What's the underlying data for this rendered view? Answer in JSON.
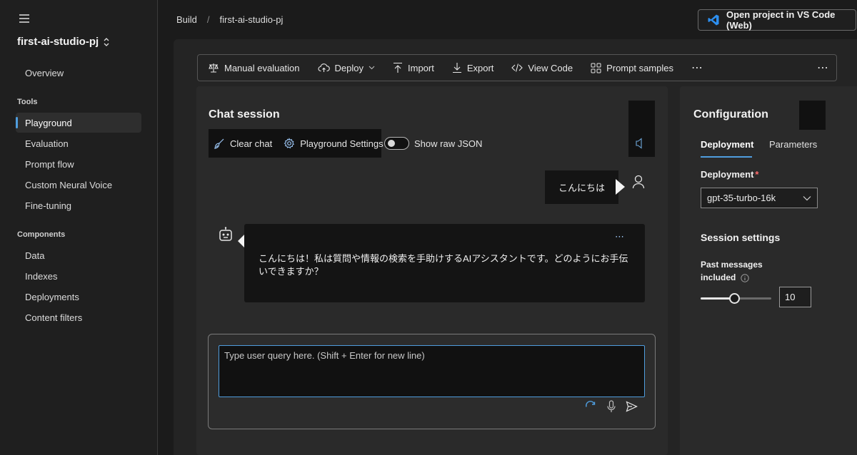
{
  "sidebar": {
    "project_name": "first-ai-studio-pj",
    "overview": "Overview",
    "tools_label": "Tools",
    "tools": [
      {
        "label": "Playground",
        "active": true
      },
      {
        "label": "Evaluation"
      },
      {
        "label": "Prompt flow"
      },
      {
        "label": "Custom Neural Voice"
      },
      {
        "label": "Fine-tuning"
      }
    ],
    "components_label": "Components",
    "components": [
      {
        "label": "Data"
      },
      {
        "label": "Indexes"
      },
      {
        "label": "Deployments"
      },
      {
        "label": "Content filters"
      }
    ]
  },
  "breadcrumb": [
    "Build",
    "first-ai-studio-pj"
  ],
  "header": {
    "vscode_button": "Open project in VS Code (Web)"
  },
  "toolbar": {
    "manual_evaluation": "Manual evaluation",
    "deploy": "Deploy",
    "import": "Import",
    "export": "Export",
    "view_code": "View Code",
    "prompt_samples": "Prompt samples"
  },
  "chat": {
    "title": "Chat session",
    "clear_chat": "Clear chat",
    "playground_settings": "Playground Settings",
    "show_raw_json": "Show raw JSON",
    "show_raw_json_on": false,
    "user_message": "こんにちは",
    "assistant_message": "こんにちは！私は質問や情報の検索を手助けするAIアシスタントです。どのようにお手伝いできますか？",
    "input_placeholder": "Type user query here. (Shift + Enter for new line)"
  },
  "config": {
    "title": "Configuration",
    "tabs": {
      "deployment": "Deployment",
      "parameters": "Parameters"
    },
    "deployment_label": "Deployment",
    "required_mark": "*",
    "deployment_value": "gpt-35-turbo-16k",
    "session_settings": "Session settings",
    "past_messages_line1": "Past messages",
    "past_messages_line2": "included",
    "past_messages_value": "10",
    "past_messages_slider_fraction": 0.47
  },
  "colors": {
    "accent": "#4f9dde",
    "background": "#1b1b1b",
    "panel": "#2a2a2a",
    "vscode_blue": "#2d8ff0"
  }
}
